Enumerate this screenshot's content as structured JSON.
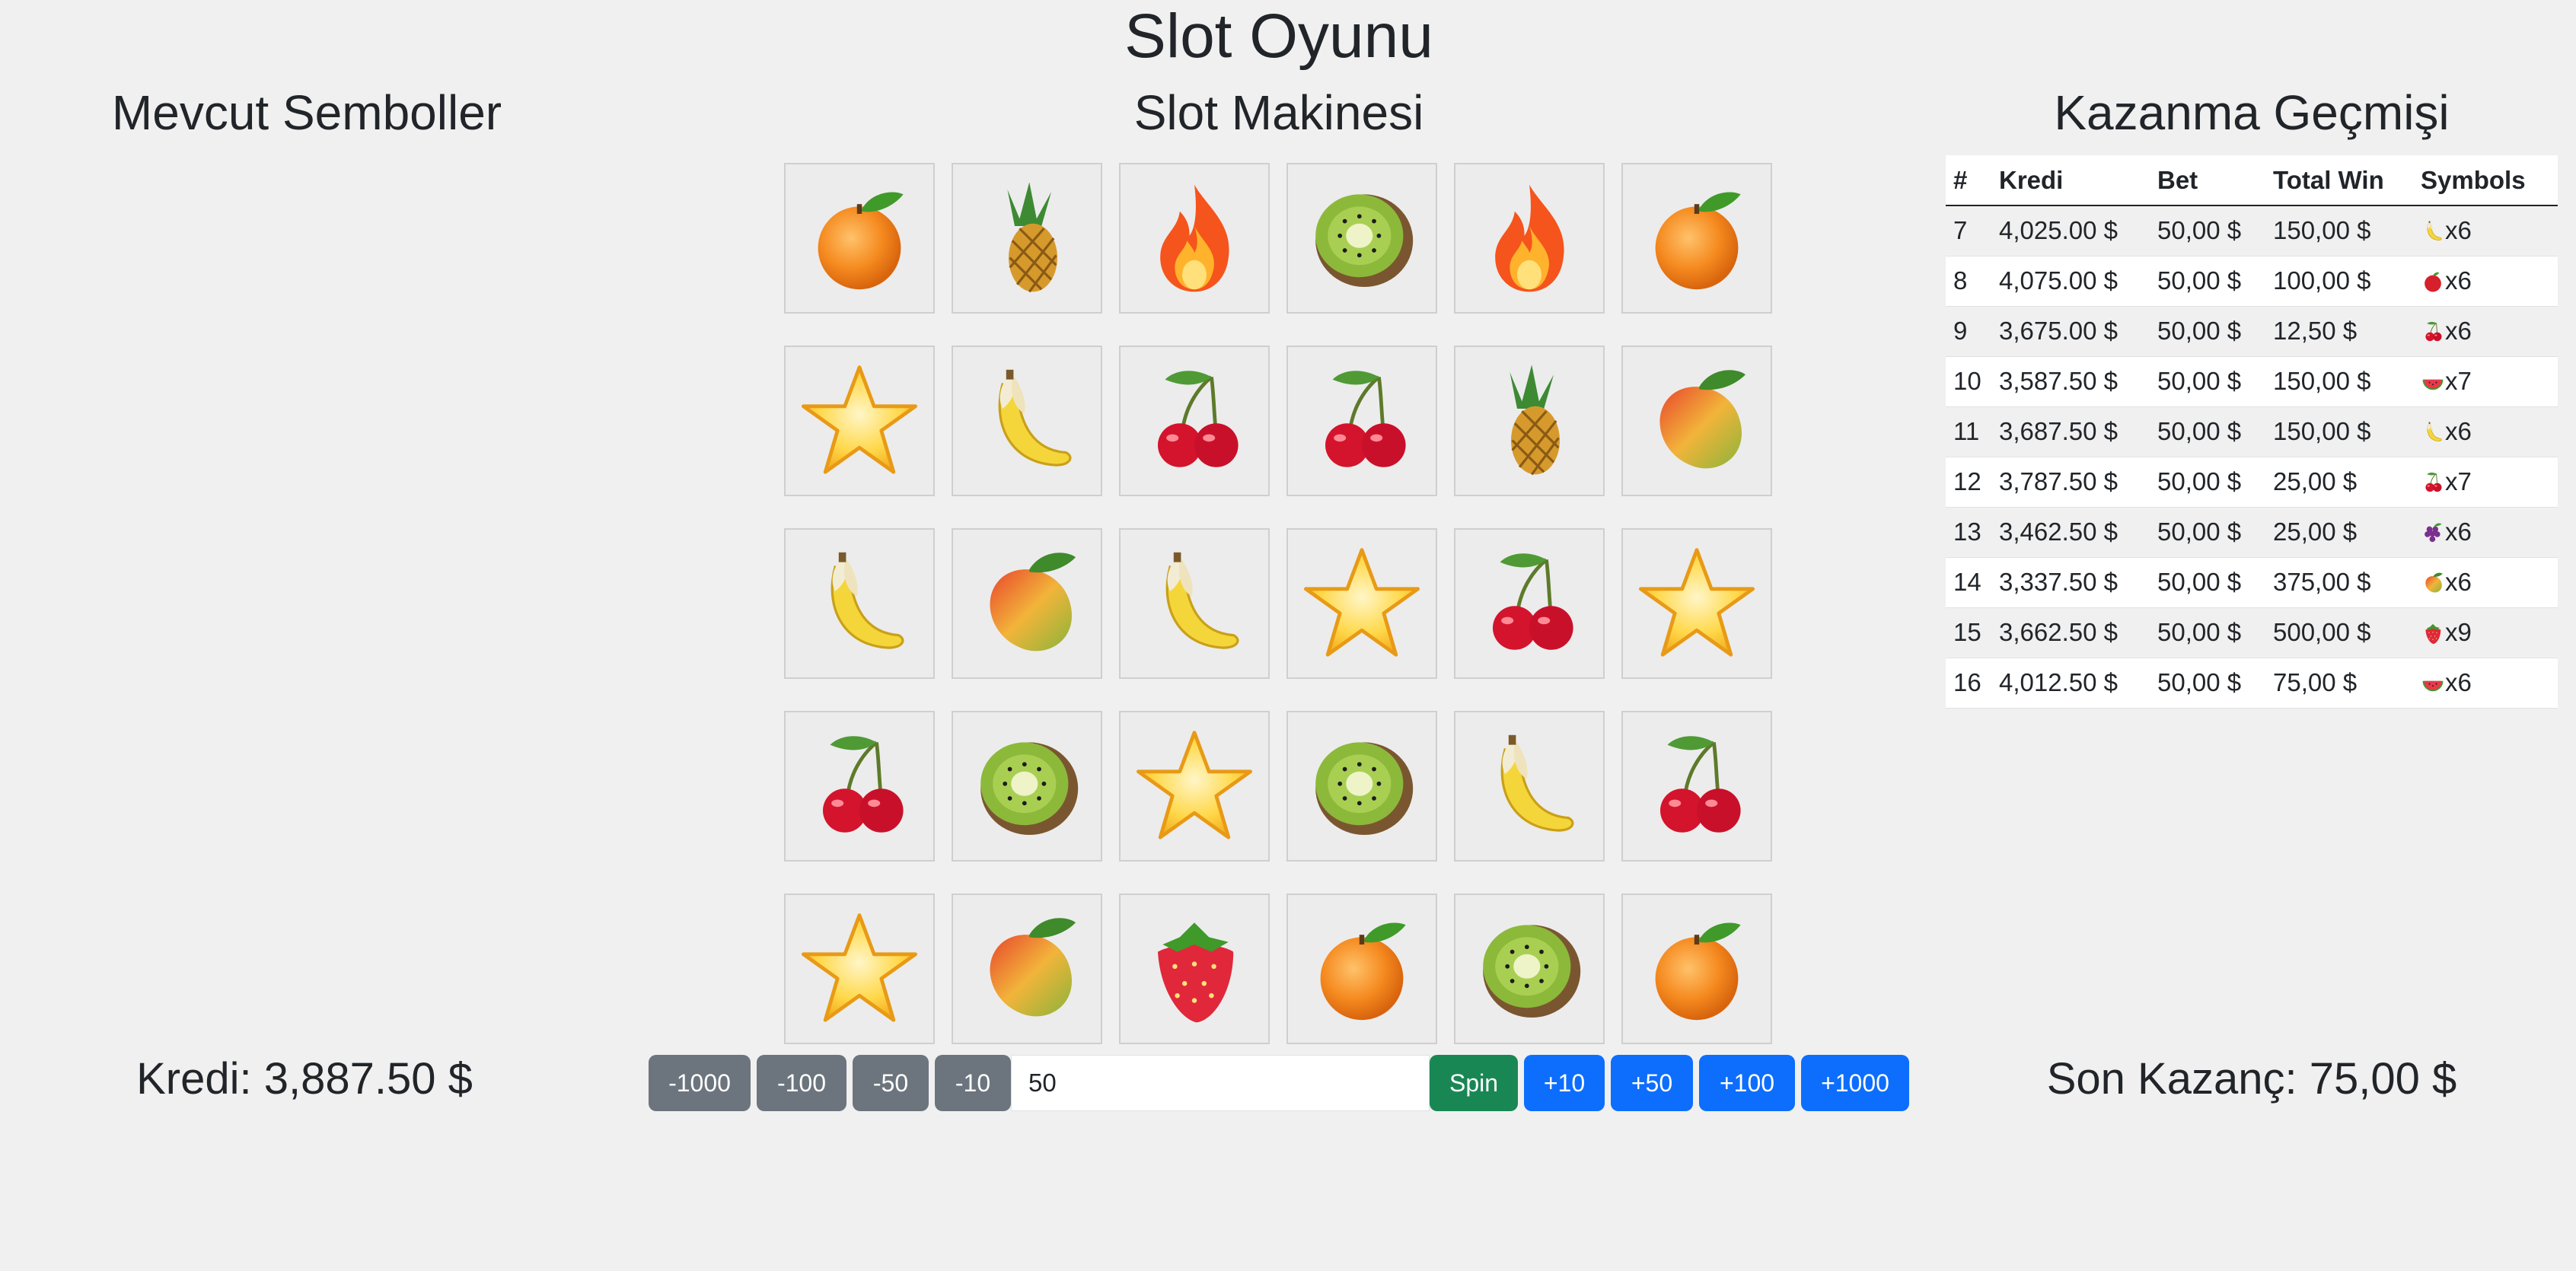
{
  "app": {
    "title": "Slot Oyunu",
    "left_heading": "Mevcut Semboller",
    "center_heading": "Slot Makinesi",
    "right_heading": "Kazanma Geçmişi"
  },
  "grid": [
    [
      "orange",
      "pineapple",
      "fire",
      "kiwi",
      "fire",
      "orange"
    ],
    [
      "star",
      "banana",
      "cherry",
      "cherry",
      "pineapple",
      "mango"
    ],
    [
      "banana",
      "mango",
      "banana",
      "star",
      "cherry",
      "star"
    ],
    [
      "cherry",
      "kiwi",
      "star",
      "kiwi",
      "banana",
      "cherry"
    ],
    [
      "star",
      "mango",
      "strawberry",
      "orange",
      "kiwi",
      "orange"
    ]
  ],
  "history": {
    "headers": [
      "#",
      "Kredi",
      "Bet",
      "Total Win",
      "Symbols"
    ],
    "rows": [
      {
        "n": "7",
        "kredi": "4,025.00 $",
        "bet": "50,00 $",
        "win": "150,00 $",
        "symbol": "banana",
        "count": "x6"
      },
      {
        "n": "8",
        "kredi": "4,075.00 $",
        "bet": "50,00 $",
        "win": "100,00 $",
        "symbol": "apple",
        "count": "x6"
      },
      {
        "n": "9",
        "kredi": "3,675.00 $",
        "bet": "50,00 $",
        "win": "12,50 $",
        "symbol": "cherry",
        "count": "x6"
      },
      {
        "n": "10",
        "kredi": "3,587.50 $",
        "bet": "50,00 $",
        "win": "150,00 $",
        "symbol": "watermelon",
        "count": "x7"
      },
      {
        "n": "11",
        "kredi": "3,687.50 $",
        "bet": "50,00 $",
        "win": "150,00 $",
        "symbol": "banana",
        "count": "x6"
      },
      {
        "n": "12",
        "kredi": "3,787.50 $",
        "bet": "50,00 $",
        "win": "25,00 $",
        "symbol": "cherry",
        "count": "x7"
      },
      {
        "n": "13",
        "kredi": "3,462.50 $",
        "bet": "50,00 $",
        "win": "25,00 $",
        "symbol": "grapes",
        "count": "x6"
      },
      {
        "n": "14",
        "kredi": "3,337.50 $",
        "bet": "50,00 $",
        "win": "375,00 $",
        "symbol": "mango",
        "count": "x6"
      },
      {
        "n": "15",
        "kredi": "3,662.50 $",
        "bet": "50,00 $",
        "win": "500,00 $",
        "symbol": "strawberry",
        "count": "x9"
      },
      {
        "n": "16",
        "kredi": "4,012.50 $",
        "bet": "50,00 $",
        "win": "75,00 $",
        "symbol": "watermelon",
        "count": "x6"
      }
    ]
  },
  "status": {
    "kredi": "Kredi: 3,887.50 $",
    "son_kazanc": "Son Kazanç: 75,00 $"
  },
  "controls": {
    "minus": [
      "-1000",
      "-100",
      "-50",
      "-10"
    ],
    "bet_value": "50",
    "spin_label": "Spin",
    "plus": [
      "+10",
      "+50",
      "+100",
      "+1000"
    ]
  },
  "colors": {
    "background": "#f0f0f0",
    "gray_button": "#6c757d",
    "blue_button": "#0d6efd",
    "spin_button": "#198754"
  }
}
